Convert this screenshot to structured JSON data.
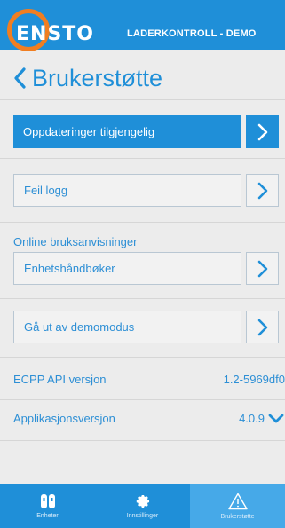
{
  "header": {
    "logo_text": "ENSTO",
    "app_title": "LADERKONTROLL - DEMO",
    "color": "#1f8fd8",
    "logo_ring_color": "#f07e21"
  },
  "page": {
    "title": "Brukerstøtte",
    "back_icon": "chevron-left-icon"
  },
  "actions": {
    "updates": "Oppdateringer tilgjengelig",
    "error_log": "Feil logg",
    "online_manuals_label": "Online bruksanvisninger",
    "device_manuals": "Enhetshåndbøker",
    "exit_demo": "Gå ut av demomodus"
  },
  "info": {
    "api_label": "ECPP API versjon",
    "api_value": "1.2-5969df0",
    "app_label": "Applikasjonsversjon",
    "app_value": "4.0.9",
    "app_value_icon": "chevron-down-icon"
  },
  "tabbar": {
    "tabs": [
      {
        "label": "Enheter",
        "icon": "device-icon"
      },
      {
        "label": "Innstillinger",
        "icon": "gear-icon"
      },
      {
        "label": "Brukerstøtte",
        "icon": "warning-icon"
      }
    ],
    "active_index": 2,
    "active_color": "#46a9e8"
  }
}
